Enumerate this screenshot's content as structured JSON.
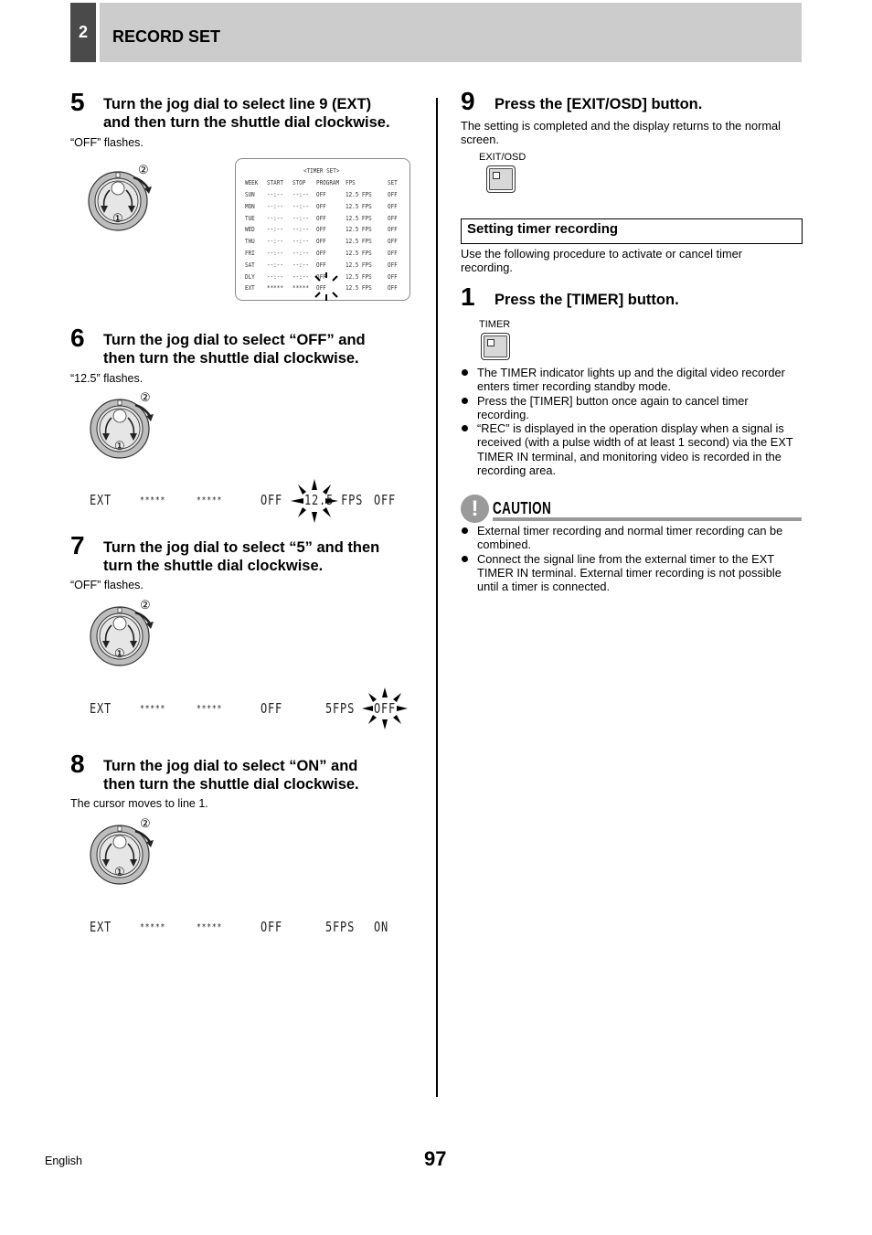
{
  "header": {
    "chapter_number": "2",
    "title": "RECORD SET",
    "colors": {
      "chapter_bg": "#4a4a4a",
      "bar_bg": "#cccccc"
    }
  },
  "steps": [
    {
      "number": "5",
      "title_line1": "Turn the jog dial to select line 9 (EXT)",
      "title_line2": "and then turn the shuttle dial clockwise.",
      "note": "“OFF” flashes."
    },
    {
      "number": "6",
      "title_line1": "Turn the jog dial to select “OFF” and",
      "title_line2": "then turn the shuttle dial clockwise.",
      "note": "“12.5” flashes.",
      "osd": {
        "week": "EXT",
        "start": "*****",
        "stop": "*****",
        "program": "OFF",
        "fps": "12.5 FPS",
        "set": "OFF",
        "flashing": "fps"
      }
    },
    {
      "number": "7",
      "title_line1": "Turn the jog dial to select “5” and then",
      "title_line2": "turn the shuttle dial clockwise.",
      "note": "“OFF” flashes.",
      "osd": {
        "week": "EXT",
        "start": "*****",
        "stop": "*****",
        "program": "OFF",
        "fps": "5FPS",
        "set": "OFF",
        "flashing": "set"
      }
    },
    {
      "number": "8",
      "title_line1": "Turn the jog dial to select “ON” and",
      "title_line2": "then turn the shuttle dial clockwise.",
      "note": "The cursor moves to line 1.",
      "osd": {
        "week": "EXT",
        "start": "*****",
        "stop": "*****",
        "program": "OFF",
        "fps": "5FPS",
        "set": "ON",
        "flashing": ""
      }
    }
  ],
  "dial": {
    "label_jog": "①",
    "label_shuttle": "②"
  },
  "timer_set_table": {
    "title": "<TIMER SET>",
    "columns": [
      "WEEK",
      "START",
      "STOP",
      "PROGRAM",
      "FPS",
      "SET"
    ],
    "rows": [
      [
        "SUN",
        "--:--",
        "--:--",
        "OFF",
        "12.5 FPS",
        "OFF"
      ],
      [
        "MON",
        "--:--",
        "--:--",
        "OFF",
        "12.5 FPS",
        "OFF"
      ],
      [
        "TUE",
        "--:--",
        "--:--",
        "OFF",
        "12.5 FPS",
        "OFF"
      ],
      [
        "WED",
        "--:--",
        "--:--",
        "OFF",
        "12.5 FPS",
        "OFF"
      ],
      [
        "THU",
        "--:--",
        "--:--",
        "OFF",
        "12.5 FPS",
        "OFF"
      ],
      [
        "FRI",
        "--:--",
        "--:--",
        "OFF",
        "12.5 FPS",
        "OFF"
      ],
      [
        "SAT",
        "--:--",
        "--:--",
        "OFF",
        "12.5 FPS",
        "OFF"
      ],
      [
        "DLY",
        "--:--",
        "--:--",
        "OFF",
        "12.5 FPS",
        "OFF"
      ],
      [
        "EXT",
        "*****",
        "*****",
        "OFF",
        "12.5 FPS",
        "OFF"
      ]
    ],
    "flashing_cell": "EXT.PROGRAM"
  },
  "step9": {
    "number": "9",
    "title": "Press the [EXIT/OSD] button.",
    "description": "The setting is completed and the display returns to the normal screen.",
    "button_label": "EXIT/OSD"
  },
  "section": {
    "title": "Setting timer recording",
    "intro": "Use the following procedure to activate or cancel timer recording.",
    "step1": {
      "number": "1",
      "title": "Press the [TIMER] button.",
      "button_label": "TIMER"
    },
    "bullets": [
      "The TIMER indicator lights up and the digital video recorder enters timer recording standby mode.",
      "Press the [TIMER] button once again to cancel timer recording.",
      "“REC” is displayed in the operation display when a signal is received (with a pulse width of at least 1 second) via the EXT TIMER IN terminal, and monitoring video is recorded in the recording area."
    ]
  },
  "caution": {
    "icon": "!",
    "label": "CAUTION",
    "bullets": [
      "External timer recording and normal timer recording can be combined.",
      "Connect the signal line from the external timer to the EXT TIMER IN terminal. External timer recording is not possible until a timer is connected."
    ]
  },
  "footer": {
    "language": "English",
    "page_number": "97"
  }
}
